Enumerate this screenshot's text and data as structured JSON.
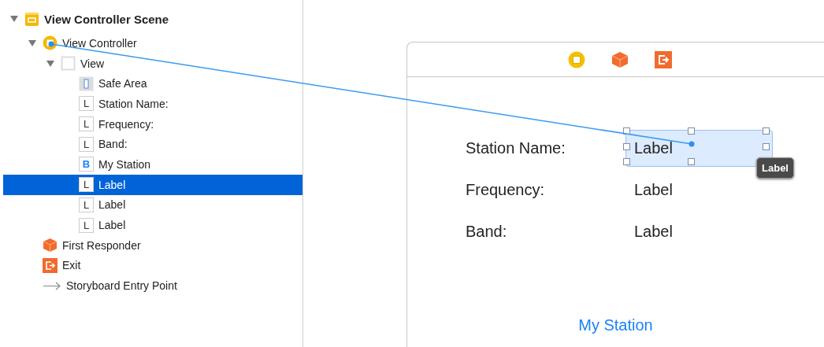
{
  "outline": {
    "items": [
      {
        "label": "View Controller Scene",
        "kind": "scene",
        "expanded": true,
        "selected": false,
        "children": [
          {
            "label": "View Controller",
            "kind": "controller",
            "expanded": true,
            "selected": false,
            "children": [
              {
                "label": "View",
                "kind": "view",
                "expanded": true,
                "selected": false,
                "children": [
                  {
                    "label": "Safe Area",
                    "kind": "safe-area",
                    "selected": false
                  },
                  {
                    "label": "Station Name:",
                    "kind": "label",
                    "glyph": "L",
                    "selected": false
                  },
                  {
                    "label": "Frequency:",
                    "kind": "label",
                    "glyph": "L",
                    "selected": false
                  },
                  {
                    "label": "Band:",
                    "kind": "label",
                    "glyph": "L",
                    "selected": false
                  },
                  {
                    "label": "My Station",
                    "kind": "button",
                    "glyph": "B",
                    "selected": false
                  },
                  {
                    "label": "Label",
                    "kind": "label",
                    "glyph": "L",
                    "selected": true
                  },
                  {
                    "label": "Label",
                    "kind": "label",
                    "glyph": "L",
                    "selected": false
                  },
                  {
                    "label": "Label",
                    "kind": "label",
                    "glyph": "L",
                    "selected": false
                  }
                ]
              }
            ]
          },
          {
            "label": "First Responder",
            "kind": "responder",
            "selected": false
          },
          {
            "label": "Exit",
            "kind": "exit",
            "selected": false
          },
          {
            "label": "Storyboard Entry Point",
            "kind": "entry",
            "selected": false
          }
        ]
      }
    ]
  },
  "canvas": {
    "rows": [
      {
        "label": "Station Name:",
        "value": "Label",
        "selected": true
      },
      {
        "label": "Frequency:",
        "value": "Label",
        "selected": false
      },
      {
        "label": "Band:",
        "value": "Label",
        "selected": false
      }
    ],
    "tooltip": "Label",
    "button": "My Station"
  }
}
